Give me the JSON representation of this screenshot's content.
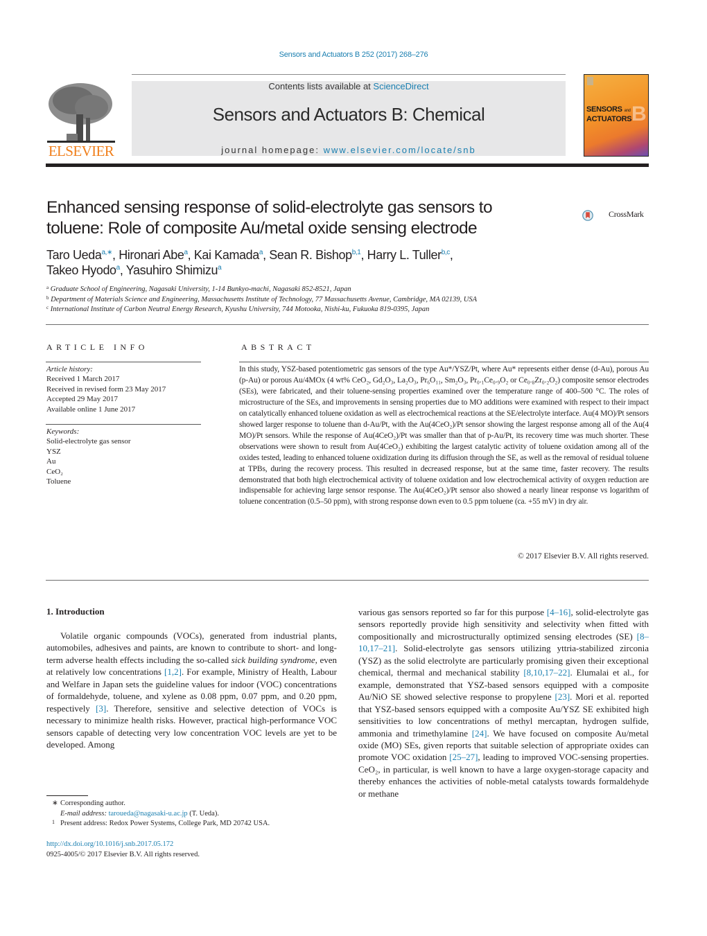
{
  "header": {
    "citation": "Sensors and Actuators B 252 (2017) 268–276",
    "publisher": "ELSEVIER",
    "contents_prefix": "Contents lists available at ",
    "contents_link": "ScienceDirect",
    "journal_title": "Sensors and Actuators B: Chemical",
    "homepage_prefix": "journal homepage: ",
    "homepage_link": "www.elsevier.com/locate/snb",
    "cover_line1": "SENSORS",
    "cover_and": "and",
    "cover_line2": "ACTUATORS",
    "cover_letter": "B",
    "colors": {
      "link": "#1a7fb0",
      "elsevier_orange": "#f07f1b",
      "banner_gray": "#e7e7e8"
    }
  },
  "article": {
    "title_line1": "Enhanced sensing response of solid-electrolyte gas sensors to",
    "title_line2": "toluene: Role of composite Au/metal oxide sensing electrode",
    "crossmark_label": "CrossMark",
    "authors": [
      {
        "name": "Taro Ueda",
        "sup": "a,∗",
        "sep": ", "
      },
      {
        "name": "Hironari Abe",
        "sup": "a",
        "sep": ", "
      },
      {
        "name": "Kai Kamada",
        "sup": "a",
        "sep": ", "
      },
      {
        "name": "Sean R. Bishop",
        "sup": "b,1",
        "sep": ", "
      },
      {
        "name": "Harry L. Tuller",
        "sup": "b,c",
        "sep": ","
      },
      {
        "name": "Takeo Hyodo",
        "sup": "a",
        "sep": ", "
      },
      {
        "name": "Yasuhiro Shimizu",
        "sup": "a",
        "sep": ""
      }
    ],
    "affiliations": [
      {
        "mark": "a",
        "text": "Graduate School of Engineering, Nagasaki University, 1-14 Bunkyo-machi, Nagasaki 852-8521, Japan"
      },
      {
        "mark": "b",
        "text": "Department of Materials Science and Engineering, Massachusetts Institute of Technology, 77 Massachusetts Avenue, Cambridge, MA 02139, USA"
      },
      {
        "mark": "c",
        "text": "International Institute of Carbon Neutral Energy Research, Kyushu University, 744 Motooka, Nishi-ku, Fukuoka 819-0395, Japan"
      }
    ]
  },
  "article_info": {
    "heading": "ARTICLE INFO",
    "history_label": "Article history:",
    "history": [
      "Received 1 March 2017",
      "Received in revised form 23 May 2017",
      "Accepted 29 May 2017",
      "Available online 1 June 2017"
    ],
    "keywords_label": "Keywords:",
    "keywords": [
      "Solid-electrolyte gas sensor",
      "YSZ",
      "Au",
      "CeO₂",
      "Toluene"
    ]
  },
  "abstract": {
    "heading": "ABSTRACT",
    "text": "In this study, YSZ-based potentiometric gas sensors of the type Au*/YSZ/Pt, where Au* represents either dense (d-Au), porous Au (p-Au) or porous Au/4MOx (4 wt% CeO₂, Gd₂O₃, La₂O₃, Pr₆O₁₁, Sm₂O₃, Pr₀.₁Ce₀.₉O₂ or Ce₀.₈Zr₀.₂O₂) composite sensor electrodes (SEs), were fabricated, and their toluene-sensing properties examined over the temperature range of 400–500 °C. The roles of microstructure of the SEs, and improvements in sensing properties due to MO additions were examined with respect to their impact on catalytically enhanced toluene oxidation as well as electrochemical reactions at the SE/electrolyte interface. Au(4 MO)/Pt sensors showed larger response to toluene than d-Au/Pt, with the Au(4CeO₂)/Pt sensor showing the largest response among all of the Au(4 MO)/Pt sensors. While the response of Au(4CeO₂)/Pt was smaller than that of p-Au/Pt, its recovery time was much shorter. These observations were shown to result from Au(4CeO₂) exhibiting the largest catalytic activity of toluene oxidation among all of the oxides tested, leading to enhanced toluene oxidization during its diffusion through the SE, as well as the removal of residual toluene at TPBs, during the recovery process. This resulted in decreased response, but at the same time, faster recovery. The results demonstrated that both high electrochemical activity of toluene oxidation and low electrochemical activity of oxygen reduction are indispensable for achieving large sensor response. The Au(4CeO₂)/Pt sensor also showed a nearly linear response vs logarithm of toluene concentration (0.5–50 ppm), with strong response down even to 0.5 ppm toluene (ca. +55 mV) in dry air.",
    "copyright": "© 2017 Elsevier B.V. All rights reserved."
  },
  "body": {
    "section_heading": "1.  Introduction",
    "left_segments": [
      {
        "t": "Volatile organic compounds (VOCs), generated from industrial plants, automobiles, adhesives and paints, are known to contribute to short- and long-term adverse health effects including the so-called "
      },
      {
        "t": "sick building syndrome",
        "i": true
      },
      {
        "t": ", even at relatively low concentrations "
      },
      {
        "t": "[1,2]",
        "link": true
      },
      {
        "t": ". For example, Ministry of Health, Labour and Welfare in Japan sets the guideline values for indoor (VOC) concentrations of formaldehyde, toluene, and xylene as 0.08 ppm, 0.07 ppm, and 0.20 ppm, respectively "
      },
      {
        "t": "[3]",
        "link": true
      },
      {
        "t": ". Therefore, sensitive and selective detection of VOCs is necessary to minimize health risks. However, practical high-performance VOC sensors capable of detecting very low concentration VOC levels are yet to be developed. Among"
      }
    ],
    "right_segments": [
      {
        "t": "various gas sensors reported so far for this purpose "
      },
      {
        "t": "[4–16]",
        "link": true
      },
      {
        "t": ", solid-electrolyte gas sensors reportedly provide high sensitivity and selectivity when fitted with compositionally and microstructurally optimized sensing electrodes (SE) "
      },
      {
        "t": "[8–10,17–21]",
        "link": true
      },
      {
        "t": ". Solid-electrolyte gas sensors utilizing yttria-stabilized zirconia (YSZ) as the solid electrolyte are particularly promising given their exceptional chemical, thermal and mechanical stability "
      },
      {
        "t": "[8,10,17–22]",
        "link": true
      },
      {
        "t": ". Elumalai et al., for example, demonstrated that YSZ-based sensors equipped with a composite Au/NiO SE showed selective response to propylene "
      },
      {
        "t": "[23]",
        "link": true
      },
      {
        "t": ". Mori et al. reported that YSZ-based sensors equipped with a composite Au/YSZ SE exhibited high sensitivities to low concentrations of methyl mercaptan, hydrogen sulfide, ammonia and trimethylamine "
      },
      {
        "t": "[24]",
        "link": true
      },
      {
        "t": ". We have focused on composite Au/metal oxide (MO) SEs, given reports that suitable selection of appropriate oxides can promote VOC oxidation "
      },
      {
        "t": "[25–27]",
        "link": true
      },
      {
        "t": ", leading to improved VOC-sensing properties. CeO₂, in particular, is well known to have a large oxygen-storage capacity and thereby enhances the activities of noble-metal catalysts towards formaldehyde or methane"
      }
    ]
  },
  "footnotes": {
    "corresponding_mark": "∗",
    "corresponding": "Corresponding author.",
    "email_label": "E-mail address:",
    "email": "taroueda@nagasaki-u.ac.jp",
    "email_suffix": " (T. Ueda).",
    "present_mark": "1",
    "present": "Present address: Redox Power Systems, College Park, MD 20742 USA.",
    "doi": "http://dx.doi.org/10.1016/j.snb.2017.05.172",
    "issn": "0925-4005/© 2017 Elsevier B.V. All rights reserved."
  }
}
